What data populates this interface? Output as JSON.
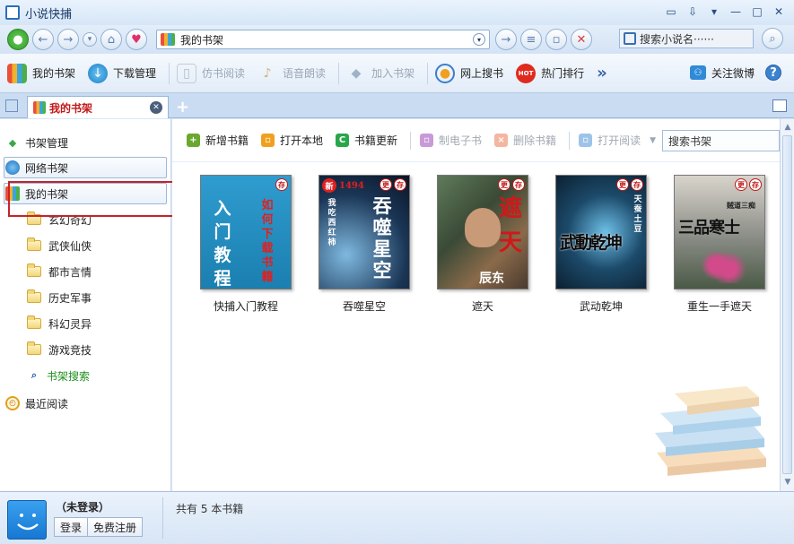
{
  "window": {
    "title": "小说快捕"
  },
  "nav": {
    "address_text": "我的书架",
    "search_placeholder": "搜索小说名······"
  },
  "toolbar": {
    "items": [
      {
        "label": "我的书架",
        "enabled": true
      },
      {
        "label": "下载管理",
        "enabled": true
      },
      {
        "label": "仿书阅读",
        "enabled": false
      },
      {
        "label": "语音朗读",
        "enabled": false
      },
      {
        "label": "加入书架",
        "enabled": false
      },
      {
        "label": "网上搜书",
        "enabled": true
      },
      {
        "label": "热门排行",
        "enabled": true
      }
    ],
    "more_label": "»",
    "follow_label": "关注微博",
    "help_label": "?"
  },
  "tab": {
    "label": "我的书架"
  },
  "sidebar": {
    "manage": "书架管理",
    "online": "网络书架",
    "mine": "我的书架",
    "folders": [
      "玄幻奇幻",
      "武侠仙侠",
      "都市言情",
      "历史军事",
      "科幻灵异",
      "游戏竞技"
    ],
    "search": "书架搜索",
    "recent": "最近阅读"
  },
  "main_toolbar": {
    "items": [
      {
        "label": "新增书籍",
        "color": "#6aa82e",
        "glyph": "+",
        "enabled": true
      },
      {
        "label": "打开本地",
        "color": "#f0a020",
        "glyph": "▫",
        "enabled": true
      },
      {
        "label": "书籍更新",
        "color": "#2aa64a",
        "glyph": "C",
        "enabled": true
      },
      {
        "label": "制电子书",
        "color": "#c89ad8",
        "glyph": "▫",
        "enabled": false
      },
      {
        "label": "删除书籍",
        "color": "#f4b6a0",
        "glyph": "×",
        "enabled": false
      },
      {
        "label": "打开阅读",
        "color": "#9dc4e8",
        "glyph": "▫",
        "enabled": false
      }
    ],
    "search_placeholder": "搜索书架"
  },
  "books": [
    {
      "title": "快捕入门教程",
      "badges": [
        "存"
      ],
      "cover_text_main": "入门教程",
      "cover_text_side": "如何下载书籍"
    },
    {
      "title": "吞噬星空",
      "badges": [
        "更",
        "存"
      ],
      "cover_text_main": "吞噬星空",
      "cover_text_side": "我吃西红柿",
      "cover_number": "1494",
      "cover_new": "新"
    },
    {
      "title": "遮天",
      "badges": [
        "更",
        "存"
      ],
      "cover_text_main": "遮天",
      "cover_text_side": "辰东"
    },
    {
      "title": "武动乾坤",
      "badges": [
        "更",
        "存"
      ],
      "cover_text_main": "武動乾坤",
      "cover_text_side": "天蚕土豆"
    },
    {
      "title": "重生一手遮天",
      "badges": [
        "更",
        "存"
      ],
      "cover_text_main": "三品寒士",
      "cover_text_side": "贼道三痴"
    }
  ],
  "status": {
    "user": "（未登录）",
    "login": "登录",
    "register": "免费注册",
    "count_text": "共有 5 本书籍"
  }
}
